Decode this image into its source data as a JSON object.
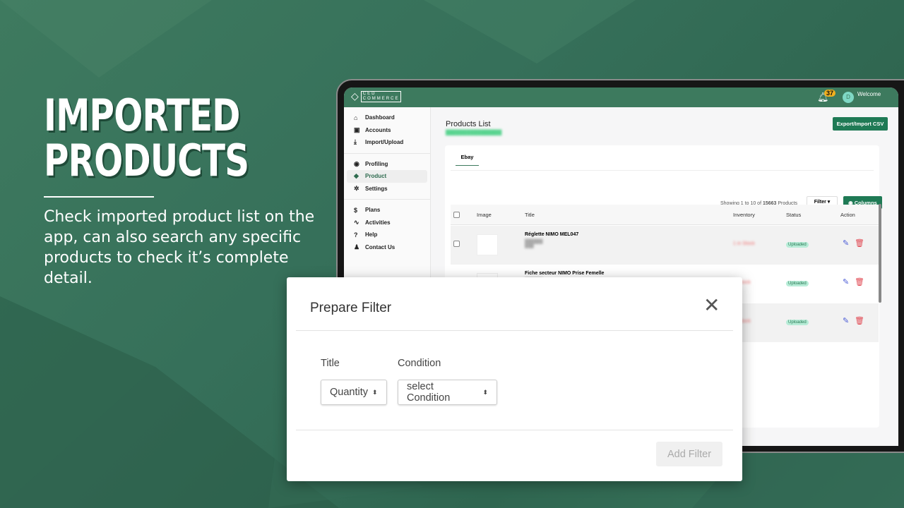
{
  "hero": {
    "title_line1": "IMPORTED",
    "title_line2": "PRODUCTS",
    "description": "Check imported product list on the app, can also search any specific products to check it’s complete detail."
  },
  "app": {
    "logo": {
      "line1": "CED",
      "line2": "COMMERCE"
    },
    "notifications_count": "37",
    "avatar_initial": "D",
    "welcome": "Welcome",
    "sidebar": {
      "group1": [
        {
          "icon": "home-icon",
          "label": "Dashboard"
        },
        {
          "icon": "accounts-icon",
          "label": "Accounts"
        },
        {
          "icon": "download-icon",
          "label": "Import/Upload"
        }
      ],
      "group2": [
        {
          "icon": "profile-icon",
          "label": "Profiling"
        },
        {
          "icon": "tag-icon",
          "label": "Product"
        },
        {
          "icon": "gear-icon",
          "label": "Settings"
        }
      ],
      "group3": [
        {
          "icon": "dollar-icon",
          "label": "Plans"
        },
        {
          "icon": "activity-icon",
          "label": "Activities"
        },
        {
          "icon": "help-icon",
          "label": "Help"
        },
        {
          "icon": "user-icon",
          "label": "Contact Us"
        }
      ]
    },
    "page_title": "Products List",
    "export_label": "Export/Import CSV",
    "tab": "Ebay",
    "showing": {
      "prefix": "Showing ",
      "from": "1",
      "mid1": " to ",
      "to": "10",
      "mid2": " of ",
      "total": "15663",
      "suffix": " Products"
    },
    "filter_label": "Filter",
    "columns_label": "Columns",
    "columns": [
      "Image",
      "Title",
      "Inventory",
      "Status",
      "Action"
    ],
    "rows": [
      {
        "title": "Réglette NIMO MEL047",
        "inventory": "1 in Stock",
        "status": "Uploaded"
      },
      {
        "title": "Fiche secteur NIMO Prise Femelle",
        "inventory": "in Stock",
        "status": "Uploaded"
      },
      {
        "title": "",
        "inventory": "in Stock",
        "status": "Uploaded"
      }
    ],
    "colors": {
      "header": "#3d7a5e",
      "accent": "#1f7a55",
      "badge": "#f2b01e",
      "delete": "#e0454f",
      "edit": "#4a5bd6"
    }
  },
  "modal": {
    "title": "Prepare Filter",
    "title_label": "Title",
    "condition_label": "Condition",
    "title_select": "Quantity",
    "condition_select": "select Condition",
    "add_filter": "Add Filter"
  }
}
